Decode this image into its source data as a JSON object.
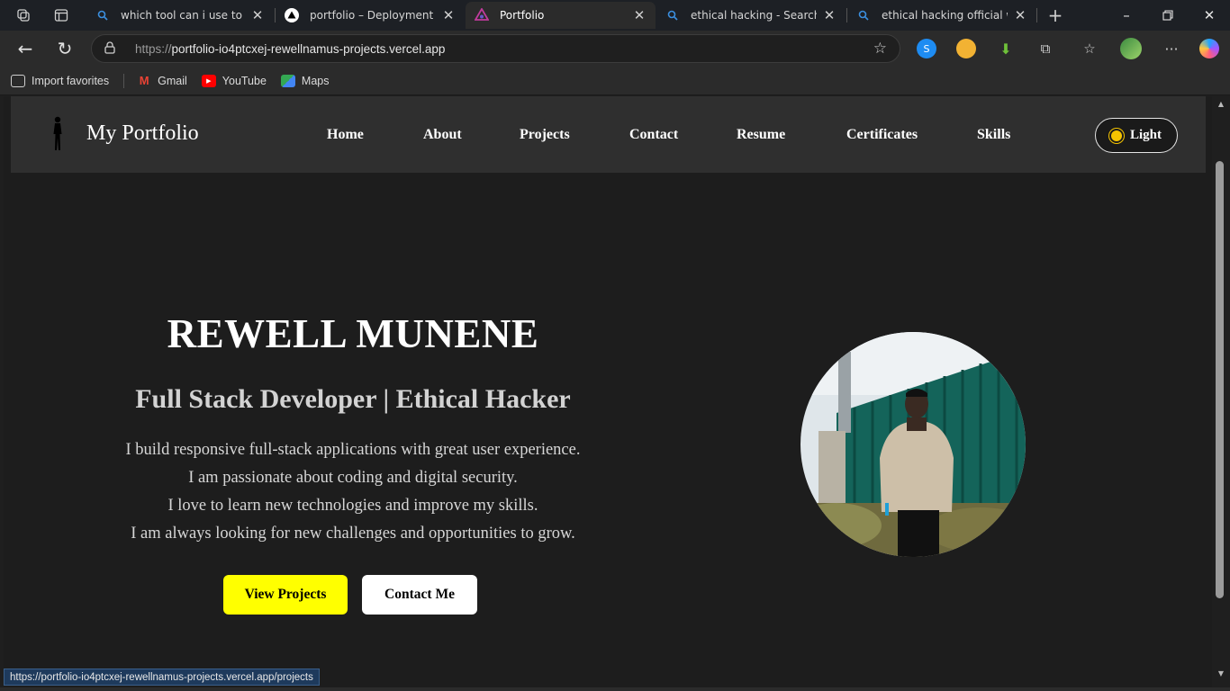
{
  "browser": {
    "tabs": [
      {
        "title": "which tool can i use to scan",
        "favicon": "search-icon",
        "active": false
      },
      {
        "title": "portfolio – Deployment Over",
        "favicon": "vercel-icon",
        "active": false
      },
      {
        "title": "Portfolio",
        "favicon": "portfolio-icon",
        "active": true
      },
      {
        "title": "ethical hacking - Search",
        "favicon": "search-icon",
        "active": false
      },
      {
        "title": "ethical hacking official web",
        "favicon": "search-icon",
        "active": false
      }
    ],
    "url_protocol": "https://",
    "url_host": "portfolio-io4ptcxej-rewellnamus-projects.vercel.app",
    "favorites": [
      {
        "label": "Import favorites",
        "icon": "import-icon"
      },
      {
        "label": "Gmail",
        "icon": "gmail-icon"
      },
      {
        "label": "YouTube",
        "icon": "youtube-icon"
      },
      {
        "label": "Maps",
        "icon": "maps-icon"
      }
    ],
    "status_url": "https://portfolio-io4ptcxej-rewellnamus-projects.vercel.app/projects"
  },
  "site": {
    "brand": "My Portfolio",
    "nav": [
      "Home",
      "About",
      "Projects",
      "Contact",
      "Resume",
      "Certificates",
      "Skills"
    ],
    "theme_toggle": "Light",
    "hero": {
      "name": "REWELL MUNENE",
      "subtitle": "Full Stack Developer | Ethical Hacker",
      "lines": [
        "I build responsive full-stack applications with great user experience.",
        "I am passionate about coding and digital security.",
        "I love to learn new technologies and improve my skills.",
        "I am always looking for new challenges and opportunities to grow."
      ],
      "primary_button": "View Projects",
      "secondary_button": "Contact Me"
    }
  },
  "colors": {
    "primary_button_bg": "#ffff00",
    "nav_bg": "#2f2f2f",
    "page_bg": "#1d1d1d"
  }
}
